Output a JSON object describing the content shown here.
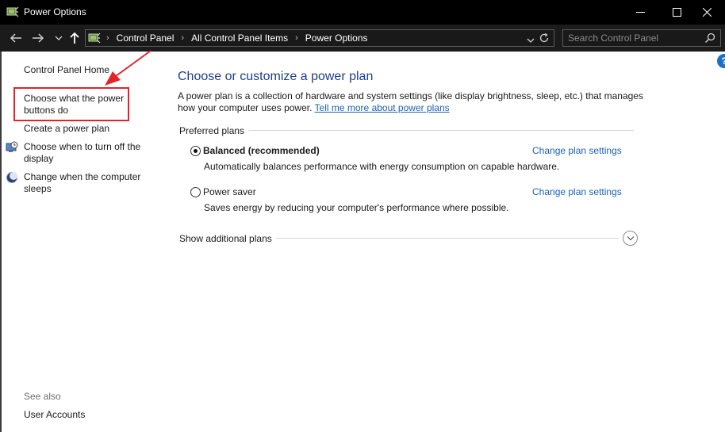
{
  "window": {
    "title": "Power Options",
    "icon": "power-options-icon"
  },
  "nav": {
    "back_icon": "back-arrow-icon",
    "forward_icon": "forward-arrow-icon",
    "recent_icon": "chevron-down-icon",
    "up_icon": "up-arrow-icon"
  },
  "address": {
    "crumbs": [
      "Control Panel",
      "All Control Panel Items",
      "Power Options"
    ]
  },
  "search": {
    "placeholder": "Search Control Panel"
  },
  "sidebar": {
    "home": "Control Panel Home",
    "items": [
      {
        "label_line1": "Choose what the power",
        "label_line2": "buttons do",
        "icon": ""
      },
      {
        "label_line1": "Create a power plan",
        "label_line2": "",
        "icon": ""
      },
      {
        "label_line1": "Choose when to turn off the",
        "label_line2": "display",
        "icon": "display-clock-icon"
      },
      {
        "label_line1": "Change when the computer",
        "label_line2": "sleeps",
        "icon": "moon-icon"
      }
    ],
    "see_also": "See also",
    "user_accounts": "User Accounts"
  },
  "main": {
    "title": "Choose or customize a power plan",
    "description": "A power plan is a collection of hardware and system settings (like display brightness, sleep, etc.) that manages how your computer uses power.",
    "learn_more": "Tell me more about power plans",
    "preferred_label": "Preferred plans",
    "plans": [
      {
        "name": "Balanced (recommended)",
        "description": "Automatically balances performance with energy consumption on capable hardware.",
        "link": "Change plan settings",
        "selected": true
      },
      {
        "name": "Power saver",
        "description": "Saves energy by reducing your computer's performance where possible.",
        "link": "Change plan settings",
        "selected": false
      }
    ],
    "show_additional": "Show additional plans"
  },
  "help": {
    "label": "?"
  },
  "colors": {
    "titlebar": "#000000",
    "addressbar": "#1b1b1b",
    "title_blue": "#1e3f8a",
    "link_blue": "#1a62b5",
    "annotation_red": "#e3232c"
  }
}
